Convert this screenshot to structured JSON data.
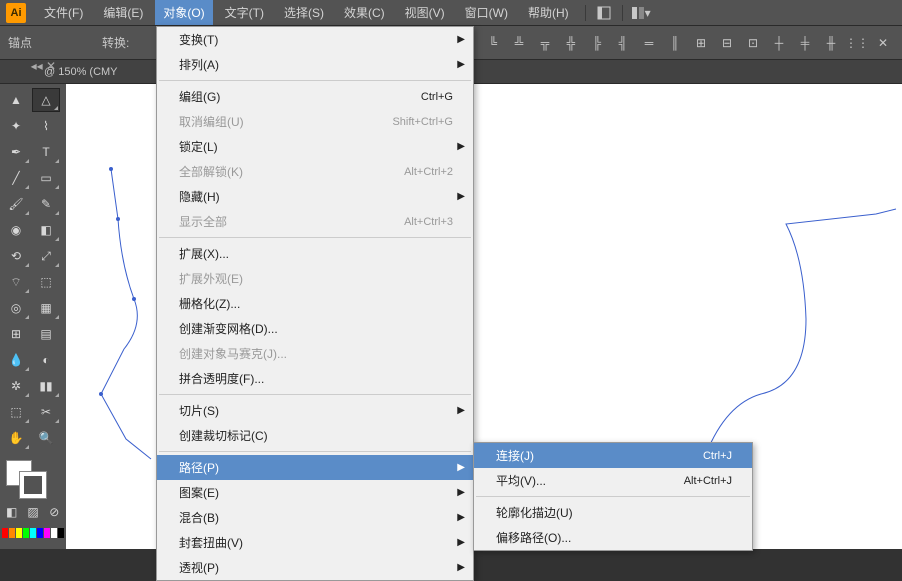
{
  "menubar": {
    "logo": "Ai",
    "items": [
      "文件(F)",
      "编辑(E)",
      "对象(O)",
      "文字(T)",
      "选择(S)",
      "效果(C)",
      "视图(V)",
      "窗口(W)",
      "帮助(H)"
    ]
  },
  "optbar": {
    "anchor": "锚点",
    "convert": "转换:"
  },
  "tab": {
    "zoom": "@ 150% (CMY"
  },
  "dropdown": [
    {
      "label": "变换(T)",
      "arrow": true
    },
    {
      "label": "排列(A)",
      "arrow": true
    },
    {
      "sep": true
    },
    {
      "label": "编组(G)",
      "shortcut": "Ctrl+G"
    },
    {
      "label": "取消编组(U)",
      "shortcut": "Shift+Ctrl+G",
      "disabled": true
    },
    {
      "label": "锁定(L)",
      "arrow": true
    },
    {
      "label": "全部解锁(K)",
      "shortcut": "Alt+Ctrl+2",
      "disabled": true
    },
    {
      "label": "隐藏(H)",
      "arrow": true
    },
    {
      "label": "显示全部",
      "shortcut": "Alt+Ctrl+3",
      "disabled": true
    },
    {
      "sep": true
    },
    {
      "label": "扩展(X)..."
    },
    {
      "label": "扩展外观(E)",
      "disabled": true
    },
    {
      "label": "栅格化(Z)..."
    },
    {
      "label": "创建渐变网格(D)..."
    },
    {
      "label": "创建对象马赛克(J)...",
      "disabled": true
    },
    {
      "label": "拼合透明度(F)..."
    },
    {
      "sep": true
    },
    {
      "label": "切片(S)",
      "arrow": true
    },
    {
      "label": "创建裁切标记(C)"
    },
    {
      "sep": true
    },
    {
      "label": "路径(P)",
      "arrow": true,
      "hl": true
    },
    {
      "label": "图案(E)",
      "arrow": true
    },
    {
      "label": "混合(B)",
      "arrow": true
    },
    {
      "label": "封套扭曲(V)",
      "arrow": true
    },
    {
      "label": "透视(P)",
      "arrow": true
    }
  ],
  "submenu": [
    {
      "label": "连接(J)",
      "shortcut": "Ctrl+J",
      "hl": true
    },
    {
      "label": "平均(V)...",
      "shortcut": "Alt+Ctrl+J"
    },
    {
      "sep": true
    },
    {
      "label": "轮廓化描边(U)"
    },
    {
      "label": "偏移路径(O)..."
    }
  ],
  "colors": [
    "#ff0000",
    "#ff8800",
    "#ffff00",
    "#00ff00",
    "#00ffff",
    "#0000ff",
    "#ff00ff",
    "#ffffff",
    "#000000"
  ]
}
